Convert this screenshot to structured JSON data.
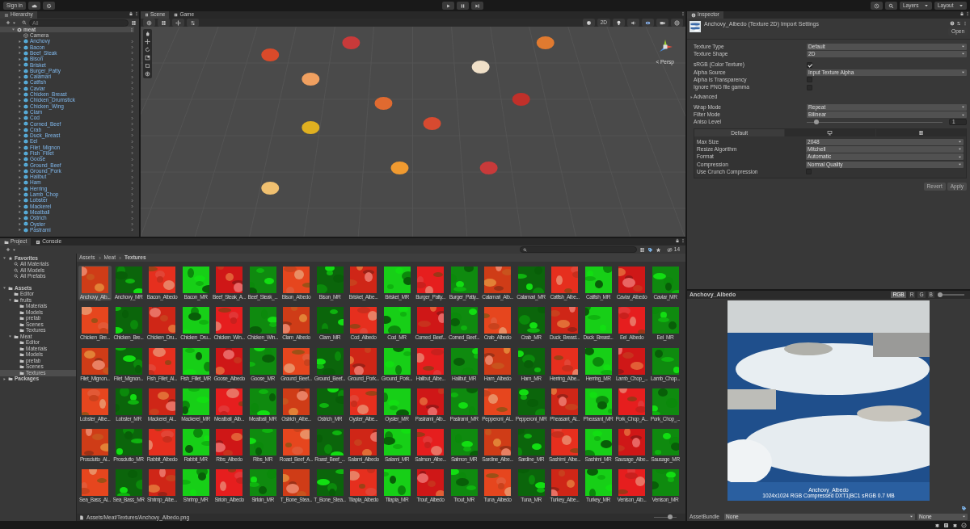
{
  "toolbar": {
    "account": "Sign in",
    "layers": "Layers",
    "layout": "Layout"
  },
  "hierarchy": {
    "title": "Hierarchy",
    "search": {
      "placeholder": "All"
    },
    "items": [
      {
        "label": "meat",
        "kind": "scene",
        "expanded": true,
        "selected": true,
        "children": [
          {
            "label": "Camera",
            "kind": "camera",
            "selected": false
          },
          {
            "label": "Anchovy",
            "kind": "prefab",
            "expanded": false,
            "selected": false
          },
          {
            "label": "Bacon",
            "kind": "prefab",
            "expanded": false,
            "selected": false
          },
          {
            "label": "Beef_Steak",
            "kind": "prefab",
            "expanded": false,
            "selected": false
          },
          {
            "label": "Bison",
            "kind": "prefab",
            "expanded": false,
            "selected": false
          },
          {
            "label": "Brisket",
            "kind": "prefab",
            "expanded": false,
            "selected": false
          },
          {
            "label": "Burger_Patty",
            "kind": "prefab",
            "expanded": false,
            "selected": false
          },
          {
            "label": "Calamari",
            "kind": "prefab",
            "expanded": false,
            "selected": false
          },
          {
            "label": "Catfish",
            "kind": "prefab",
            "expanded": false,
            "selected": false
          },
          {
            "label": "Caviar",
            "kind": "prefab",
            "expanded": false,
            "selected": false
          },
          {
            "label": "Chicken_Breast",
            "kind": "prefab",
            "expanded": false,
            "selected": false
          },
          {
            "label": "Chicken_Drumstick",
            "kind": "prefab",
            "expanded": false,
            "selected": false
          },
          {
            "label": "Chicken_Wing",
            "kind": "prefab",
            "expanded": false,
            "selected": false
          },
          {
            "label": "Clam",
            "kind": "prefab",
            "expanded": false,
            "selected": false
          },
          {
            "label": "Cod",
            "kind": "prefab",
            "expanded": false,
            "selected": false
          },
          {
            "label": "Corned_Beef",
            "kind": "prefab",
            "expanded": false,
            "selected": false
          },
          {
            "label": "Crab",
            "kind": "prefab",
            "expanded": false,
            "selected": false
          },
          {
            "label": "Duck_Breast",
            "kind": "prefab",
            "expanded": false,
            "selected": false
          },
          {
            "label": "Eel",
            "kind": "prefab",
            "expanded": false,
            "selected": false
          },
          {
            "label": "Filet_Mignon",
            "kind": "prefab",
            "expanded": false,
            "selected": false
          },
          {
            "label": "Fish_Fillet",
            "kind": "prefab",
            "expanded": false,
            "selected": false
          },
          {
            "label": "Goose",
            "kind": "prefab",
            "expanded": false,
            "selected": false
          },
          {
            "label": "Ground_Beef",
            "kind": "prefab",
            "expanded": false,
            "selected": false
          },
          {
            "label": "Ground_Pork",
            "kind": "prefab",
            "expanded": false,
            "selected": false
          },
          {
            "label": "Halibut",
            "kind": "prefab",
            "expanded": false,
            "selected": false
          },
          {
            "label": "Ham",
            "kind": "prefab",
            "expanded": false,
            "selected": false
          },
          {
            "label": "Herring",
            "kind": "prefab",
            "expanded": false,
            "selected": false
          },
          {
            "label": "Lamb_Chop",
            "kind": "prefab",
            "expanded": false,
            "selected": false
          },
          {
            "label": "Lobster",
            "kind": "prefab",
            "expanded": false,
            "selected": false
          },
          {
            "label": "Mackerel",
            "kind": "prefab",
            "expanded": false,
            "selected": false
          },
          {
            "label": "Meatball",
            "kind": "prefab",
            "expanded": false,
            "selected": false
          },
          {
            "label": "Ostrich",
            "kind": "prefab",
            "expanded": false,
            "selected": false
          },
          {
            "label": "Oyster",
            "kind": "prefab",
            "expanded": false,
            "selected": false
          },
          {
            "label": "Pastrami",
            "kind": "prefab",
            "expanded": false,
            "selected": false
          }
        ]
      }
    ]
  },
  "scene": {
    "tabs": [
      {
        "label": "Scene",
        "selected": true
      },
      {
        "label": "Game",
        "selected": false
      }
    ],
    "mode_2d": {
      "label": "2D",
      "on": false
    },
    "projection": "< Persp"
  },
  "inspector": {
    "title": "Inspector",
    "header": "Anchovy_Albedo (Texture 2D) Import Settings",
    "open_button": "Open",
    "fields": [
      {
        "label": "Texture Type",
        "kind": "dropdown",
        "value": "Default"
      },
      {
        "label": "Texture Shape",
        "kind": "dropdown",
        "value": "2D"
      },
      {
        "label": "sRGB (Color Texture)",
        "kind": "checkbox",
        "checked": true
      },
      {
        "label": "Alpha Source",
        "kind": "dropdown",
        "value": "Input Texture Alpha"
      },
      {
        "label": "Alpha Is Transparency",
        "kind": "checkbox",
        "checked": false
      },
      {
        "label": "Ignore PNG file gamma",
        "kind": "checkbox",
        "checked": false
      },
      {
        "label": "Advanced",
        "kind": "foldout",
        "expanded": false
      },
      {
        "label": "Wrap Mode",
        "kind": "dropdown",
        "value": "Repeat"
      },
      {
        "label": "Filter Mode",
        "kind": "dropdown",
        "value": "Bilinear"
      },
      {
        "label": "Aniso Level",
        "kind": "slider",
        "level": 0.07,
        "value": "1"
      }
    ],
    "platform_tabs": [
      {
        "kind": "text",
        "label": "Default",
        "selected": true
      },
      {
        "kind": "monitor",
        "selected": false
      },
      {
        "kind": "grid",
        "selected": false
      }
    ],
    "platform_fields": [
      {
        "label": "Max Size",
        "kind": "dropdown",
        "value": "2048"
      },
      {
        "label": "Resize Algorithm",
        "kind": "dropdown",
        "value": "Mitchell"
      },
      {
        "label": "Format",
        "kind": "dropdown",
        "value": "Automatic"
      },
      {
        "label": "Compression",
        "kind": "dropdown",
        "value": "Normal Quality"
      },
      {
        "label": "Use Crunch Compression",
        "kind": "checkbox",
        "checked": false
      }
    ],
    "buttons": [
      {
        "label": "Revert",
        "disabled": true
      },
      {
        "label": "Apply",
        "disabled": true
      }
    ]
  },
  "project": {
    "tabs": [
      {
        "label": "Project",
        "selected": true
      },
      {
        "label": "Console",
        "selected": false
      }
    ],
    "tree": [
      {
        "label": "Favorites",
        "kind": "favorites",
        "expanded": true,
        "selected": false,
        "children": [
          {
            "label": "All Materials",
            "kind": "search",
            "selected": false
          },
          {
            "label": "All Models",
            "kind": "search",
            "selected": false
          },
          {
            "label": "All Prefabs",
            "kind": "search",
            "selected": false
          }
        ]
      },
      {
        "label": "Assets",
        "kind": "folder",
        "expanded": true,
        "selected": false,
        "children": [
          {
            "label": "Editor",
            "kind": "folder",
            "selected": false
          },
          {
            "label": "fruits",
            "kind": "folder",
            "expanded": true,
            "selected": false,
            "children": [
              {
                "label": "Materials",
                "kind": "folder",
                "selected": false
              },
              {
                "label": "Models",
                "kind": "folder",
                "selected": false
              },
              {
                "label": "prefab",
                "kind": "folder",
                "selected": false
              },
              {
                "label": "Scenes",
                "kind": "folder",
                "selected": false
              },
              {
                "label": "Textures",
                "kind": "folder",
                "selected": false
              }
            ]
          },
          {
            "label": "Meat",
            "kind": "folder",
            "expanded": true,
            "selected": false,
            "children": [
              {
                "label": "Editor",
                "kind": "folder",
                "selected": false
              },
              {
                "label": "Materials",
                "kind": "folder",
                "selected": false
              },
              {
                "label": "Models",
                "kind": "folder",
                "selected": false
              },
              {
                "label": "prefab",
                "kind": "folder",
                "selected": false
              },
              {
                "label": "Scenes",
                "kind": "folder",
                "selected": false
              },
              {
                "label": "Textures",
                "kind": "folder",
                "selected": true
              }
            ]
          }
        ]
      },
      {
        "label": "Packages",
        "kind": "folder",
        "expanded": false,
        "selected": false
      }
    ],
    "breadcrumbs": [
      "Assets",
      "Meat",
      "Textures"
    ],
    "hidden_count": "14",
    "assets": [
      {
        "label": "Anchovy_Alb...",
        "selected": true
      },
      {
        "label": "Anchovy_MR",
        "selected": false
      },
      {
        "label": "Bacon_Albedo",
        "selected": false
      },
      {
        "label": "Bacon_MR",
        "selected": false
      },
      {
        "label": "Beef_Steak_A...",
        "selected": false
      },
      {
        "label": "Beef_Steak_...",
        "selected": false
      },
      {
        "label": "Bison_Albedo",
        "selected": false
      },
      {
        "label": "Bison_MR",
        "selected": false
      },
      {
        "label": "Brisket_Albe...",
        "selected": false
      },
      {
        "label": "Brisket_MR",
        "selected": false
      },
      {
        "label": "Burger_Patty...",
        "selected": false
      },
      {
        "label": "Burger_Patty...",
        "selected": false
      },
      {
        "label": "Calamari_Alb...",
        "selected": false
      },
      {
        "label": "Calamari_MR",
        "selected": false
      },
      {
        "label": "Catfish_Albe...",
        "selected": false
      },
      {
        "label": "Catfish_MR",
        "selected": false
      },
      {
        "label": "Caviar_Albedo",
        "selected": false
      },
      {
        "label": "Caviar_MR",
        "selected": false
      },
      {
        "label": "Chicken_Bre...",
        "selected": false
      },
      {
        "label": "Chicken_Bre...",
        "selected": false
      },
      {
        "label": "Chicken_Dru...",
        "selected": false
      },
      {
        "label": "Chicken_Dru...",
        "selected": false
      },
      {
        "label": "Chicken_Win...",
        "selected": false
      },
      {
        "label": "Chicken_Win...",
        "selected": false
      },
      {
        "label": "Clam_Albedo",
        "selected": false
      },
      {
        "label": "Clam_MR",
        "selected": false
      },
      {
        "label": "Cod_Albedo",
        "selected": false
      },
      {
        "label": "Cod_MR",
        "selected": false
      },
      {
        "label": "Corned_Beef...",
        "selected": false
      },
      {
        "label": "Corned_Beef...",
        "selected": false
      },
      {
        "label": "Crab_Albedo",
        "selected": false
      },
      {
        "label": "Crab_MR",
        "selected": false
      },
      {
        "label": "Duck_Breast...",
        "selected": false
      },
      {
        "label": "Duck_Breast...",
        "selected": false
      },
      {
        "label": "Eel_Albedo",
        "selected": false
      },
      {
        "label": "Eel_MR",
        "selected": false
      },
      {
        "label": "Filet_Mignon...",
        "selected": false
      },
      {
        "label": "Filet_Mignon...",
        "selected": false
      },
      {
        "label": "Fish_Fillet_Al...",
        "selected": false
      },
      {
        "label": "Fish_Fillet_MR",
        "selected": false
      },
      {
        "label": "Goose_Albedo",
        "selected": false
      },
      {
        "label": "Goose_MR",
        "selected": false
      },
      {
        "label": "Ground_Beef...",
        "selected": false
      },
      {
        "label": "Ground_Beef...",
        "selected": false
      },
      {
        "label": "Ground_Pork...",
        "selected": false
      },
      {
        "label": "Ground_Pork...",
        "selected": false
      },
      {
        "label": "Halibut_Albe...",
        "selected": false
      },
      {
        "label": "Halibut_MR",
        "selected": false
      },
      {
        "label": "Ham_Albedo",
        "selected": false
      },
      {
        "label": "Ham_MR",
        "selected": false
      },
      {
        "label": "Herring_Albe...",
        "selected": false
      },
      {
        "label": "Herring_MR",
        "selected": false
      },
      {
        "label": "Lamb_Chop_...",
        "selected": false
      },
      {
        "label": "Lamb_Chop...",
        "selected": false
      },
      {
        "label": "Lobster_Albe...",
        "selected": false
      },
      {
        "label": "Lobster_MR",
        "selected": false
      },
      {
        "label": "Mackerel_Al...",
        "selected": false
      },
      {
        "label": "Mackerel_MR",
        "selected": false
      },
      {
        "label": "Meatball_Alb...",
        "selected": false
      },
      {
        "label": "Meatball_MR",
        "selected": false
      },
      {
        "label": "Ostrich_Albe...",
        "selected": false
      },
      {
        "label": "Ostrich_MR",
        "selected": false
      },
      {
        "label": "Oyster_Albe...",
        "selected": false
      },
      {
        "label": "Oyster_MR",
        "selected": false
      },
      {
        "label": "Pastrami_Alb...",
        "selected": false
      },
      {
        "label": "Pastrami_MR",
        "selected": false
      },
      {
        "label": "Pepperoni_Al...",
        "selected": false
      },
      {
        "label": "Pepperoni_MR",
        "selected": false
      },
      {
        "label": "Pheasant_Al...",
        "selected": false
      },
      {
        "label": "Pheasant_MR",
        "selected": false
      },
      {
        "label": "Pork_Chop_A...",
        "selected": false
      },
      {
        "label": "Pork_Chop_...",
        "selected": false
      },
      {
        "label": "Prosciutto_Al...",
        "selected": false
      },
      {
        "label": "Prosciutto_MR",
        "selected": false
      },
      {
        "label": "Rabbit_Albedo",
        "selected": false
      },
      {
        "label": "Rabbit_MR",
        "selected": false
      },
      {
        "label": "Ribs_Albedo",
        "selected": false
      },
      {
        "label": "Ribs_MR",
        "selected": false
      },
      {
        "label": "Roast_Beef_A...",
        "selected": false
      },
      {
        "label": "Roast_Beef_...",
        "selected": false
      },
      {
        "label": "Salami_Albedo",
        "selected": false
      },
      {
        "label": "Salami_MR",
        "selected": false
      },
      {
        "label": "Salmon_Albe...",
        "selected": false
      },
      {
        "label": "Salmon_MR",
        "selected": false
      },
      {
        "label": "Sardine_Albe...",
        "selected": false
      },
      {
        "label": "Sardine_MR",
        "selected": false
      },
      {
        "label": "Sashimi_Albe...",
        "selected": false
      },
      {
        "label": "Sashimi_MR",
        "selected": false
      },
      {
        "label": "Sausage_Albe...",
        "selected": false
      },
      {
        "label": "Sausage_MR",
        "selected": false
      },
      {
        "label": "Sea_Bass_Al...",
        "selected": false
      },
      {
        "label": "Sea_Bass_MR",
        "selected": false
      },
      {
        "label": "Shrimp_Albe...",
        "selected": false
      },
      {
        "label": "Shrimp_MR",
        "selected": false
      },
      {
        "label": "Sirloin_Albedo",
        "selected": false
      },
      {
        "label": "Sirloin_MR",
        "selected": false
      },
      {
        "label": "T_Bone_Stea...",
        "selected": false
      },
      {
        "label": "T_Bone_Stea...",
        "selected": false
      },
      {
        "label": "Tilapia_Albedo",
        "selected": false
      },
      {
        "label": "Tilapia_MR",
        "selected": false
      },
      {
        "label": "Trout_Albedo",
        "selected": false
      },
      {
        "label": "Trout_MR",
        "selected": false
      },
      {
        "label": "Tuna_Albedo",
        "selected": false
      },
      {
        "label": "Tuna_MR",
        "selected": false
      },
      {
        "label": "Turkey_Albe...",
        "selected": false
      },
      {
        "label": "Turkey_MR",
        "selected": false
      },
      {
        "label": "Venison_Alb...",
        "selected": false
      },
      {
        "label": "Venison_MR",
        "selected": false
      }
    ],
    "path": "Assets/Meat/Textures/Anchovy_Albedo.png",
    "zoom": {
      "level": 0.7
    }
  },
  "preview": {
    "title": "Anchovy_Albedo",
    "channels": [
      {
        "label": "RGB",
        "selected": true
      },
      {
        "label": "R",
        "selected": false
      },
      {
        "label": "G",
        "selected": false
      },
      {
        "label": "B",
        "selected": false
      }
    ],
    "mip": {
      "level": 0
    },
    "caption": "Anchovy_Albedo",
    "info": "1024x1024  RGB Compressed DXT1|BC1 sRGB  0.7 MB",
    "asset_bundle": {
      "label": "AssetBundle",
      "values": [
        "None",
        "None"
      ]
    }
  }
}
